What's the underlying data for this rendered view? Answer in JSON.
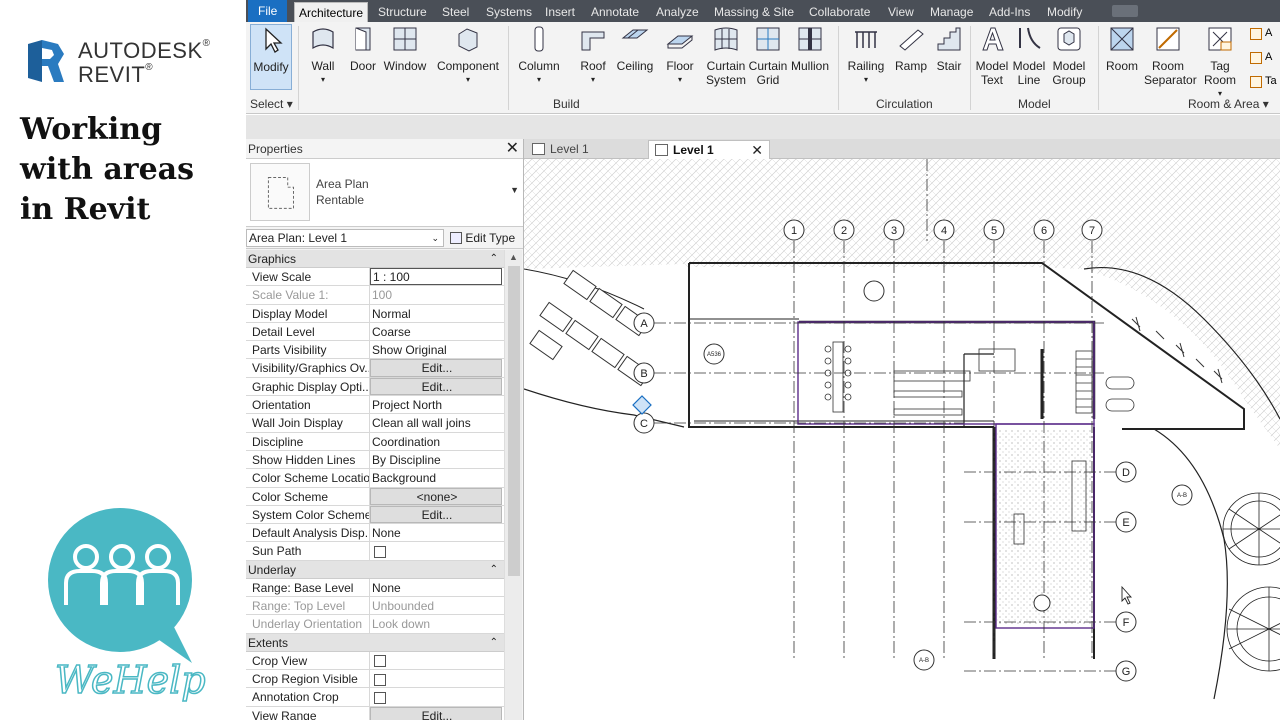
{
  "branding": {
    "autodesk": "AUTODESK",
    "revit": "REVIT",
    "reg_mark": "®",
    "tutorial_title_lines": [
      "Working",
      "with areas",
      "in Revit"
    ],
    "wehelp": "WeHelp",
    "colors": {
      "revit_blue": "#1d5f9a",
      "wehelp_teal": "#4ab8c4"
    }
  },
  "menubar": {
    "tabs": [
      "File",
      "Architecture",
      "Structure",
      "Steel",
      "Systems",
      "Insert",
      "Annotate",
      "Analyze",
      "Massing & Site",
      "Collaborate",
      "View",
      "Manage",
      "Add-Ins",
      "Modify"
    ],
    "active": "Architecture"
  },
  "ribbon": {
    "buttons": [
      {
        "label": "Modify",
        "icon": "cursor-arrow-icon"
      },
      {
        "label": "Wall",
        "icon": "wall-icon"
      },
      {
        "label": "Door",
        "icon": "door-icon"
      },
      {
        "label": "Window",
        "icon": "window-icon"
      },
      {
        "label": "Component",
        "icon": "component-icon"
      },
      {
        "label": "Column",
        "icon": "column-icon"
      },
      {
        "label": "Roof",
        "icon": "roof-icon"
      },
      {
        "label": "Ceiling",
        "icon": "ceiling-icon"
      },
      {
        "label": "Floor",
        "icon": "floor-icon"
      },
      {
        "label": "Curtain System",
        "icon": "curtain-system-icon"
      },
      {
        "label": "Curtain Grid",
        "icon": "curtain-grid-icon"
      },
      {
        "label": "Mullion",
        "icon": "mullion-icon"
      },
      {
        "label": "Railing",
        "icon": "railing-icon"
      },
      {
        "label": "Ramp",
        "icon": "ramp-icon"
      },
      {
        "label": "Stair",
        "icon": "stair-icon"
      },
      {
        "label": "Model Text",
        "icon": "model-text-icon"
      },
      {
        "label": "Model Line",
        "icon": "model-line-icon"
      },
      {
        "label": "Model Group",
        "icon": "model-group-icon"
      },
      {
        "label": "Room",
        "icon": "room-icon"
      },
      {
        "label": "Room Separator",
        "icon": "room-separator-icon"
      },
      {
        "label": "Tag Room",
        "icon": "tag-room-icon"
      }
    ],
    "small_items": [
      "A",
      "A",
      "Ta"
    ],
    "groups": [
      "Select",
      "Build",
      "Circulation",
      "Model",
      "Room & Area"
    ]
  },
  "properties": {
    "title": "Properties",
    "type_name": "Area Plan",
    "type_subname": "Rentable",
    "instance_selector": "Area Plan: Level 1",
    "edit_type": "Edit Type",
    "sections": [
      {
        "name": "Graphics",
        "rows": [
          {
            "name": "View Scale",
            "value": "1 : 100",
            "kind": "input"
          },
          {
            "name": "Scale Value    1:",
            "value": "100",
            "kind": "grey"
          },
          {
            "name": "Display Model",
            "value": "Normal"
          },
          {
            "name": "Detail Level",
            "value": "Coarse"
          },
          {
            "name": "Parts Visibility",
            "value": "Show Original"
          },
          {
            "name": "Visibility/Graphics Ov...",
            "value": "Edit...",
            "kind": "btn"
          },
          {
            "name": "Graphic Display Opti...",
            "value": "Edit...",
            "kind": "btn"
          },
          {
            "name": "Orientation",
            "value": "Project North"
          },
          {
            "name": "Wall Join Display",
            "value": "Clean all wall joins"
          },
          {
            "name": "Discipline",
            "value": "Coordination"
          },
          {
            "name": "Show Hidden Lines",
            "value": "By Discipline"
          },
          {
            "name": "Color Scheme Location",
            "value": "Background"
          },
          {
            "name": "Color Scheme",
            "value": "<none>",
            "kind": "btn"
          },
          {
            "name": "System Color Schemes",
            "value": "Edit...",
            "kind": "btn"
          },
          {
            "name": "Default Analysis Disp...",
            "value": "None"
          },
          {
            "name": "Sun Path",
            "value": "",
            "kind": "check"
          }
        ]
      },
      {
        "name": "Underlay",
        "rows": [
          {
            "name": "Range: Base Level",
            "value": "None"
          },
          {
            "name": "Range: Top Level",
            "value": "Unbounded",
            "kind": "grey"
          },
          {
            "name": "Underlay Orientation",
            "value": "Look down",
            "kind": "grey"
          }
        ]
      },
      {
        "name": "Extents",
        "rows": [
          {
            "name": "Crop View",
            "value": "",
            "kind": "check"
          },
          {
            "name": "Crop Region Visible",
            "value": "",
            "kind": "check"
          },
          {
            "name": "Annotation Crop",
            "value": "",
            "kind": "check"
          },
          {
            "name": "View Range",
            "value": "Edit...",
            "kind": "btn"
          }
        ]
      }
    ]
  },
  "view_tabs": [
    {
      "label": "Level 1",
      "active": false
    },
    {
      "label": "Level 1",
      "active": true
    }
  ],
  "drawing": {
    "grid_columns": [
      "1",
      "2",
      "3",
      "4",
      "5",
      "6",
      "7"
    ],
    "grid_rows": [
      "A",
      "B",
      "C",
      "D",
      "E",
      "F",
      "G"
    ],
    "section_tags": [
      "A536",
      "A-B",
      "A-B"
    ],
    "colors": {
      "area_boundary": "#5b2c8a",
      "lines": "#222222"
    }
  }
}
